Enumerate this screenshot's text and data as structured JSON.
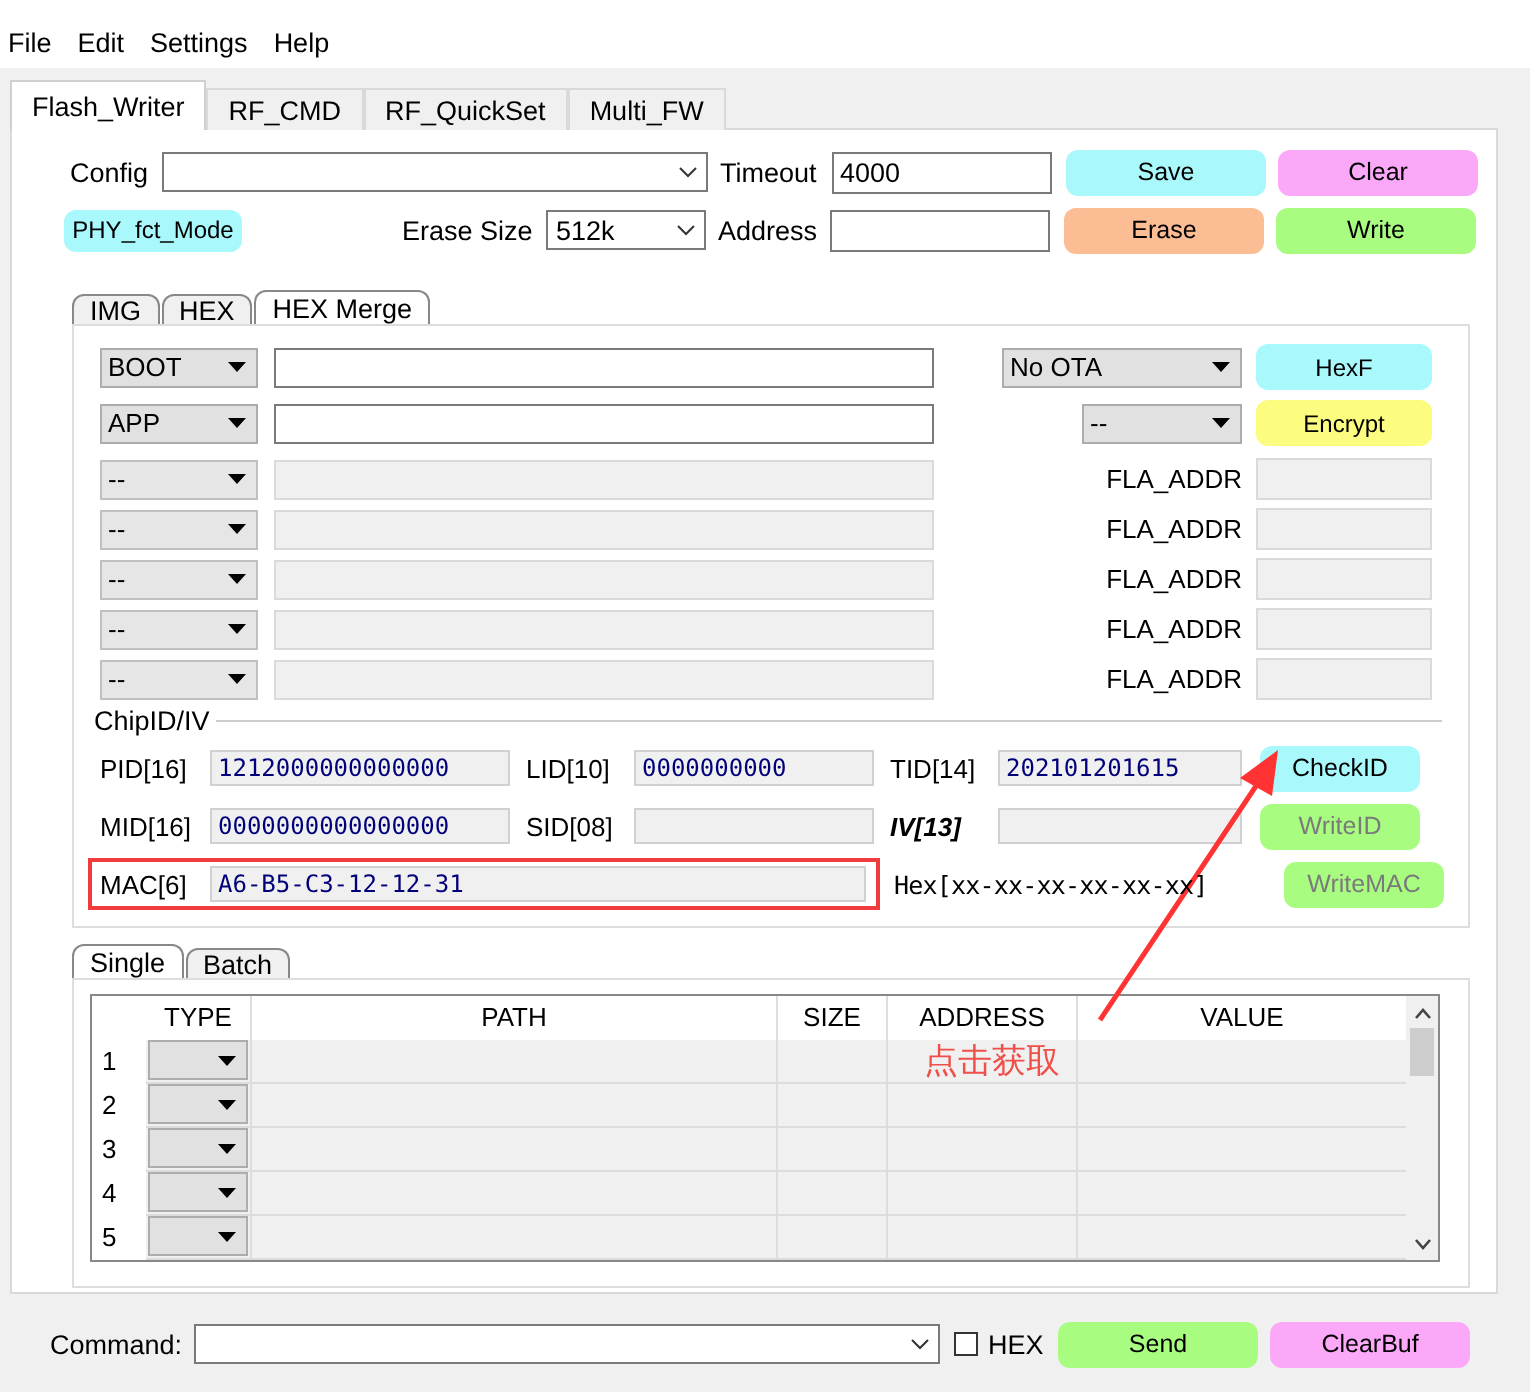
{
  "menu": [
    "File",
    "Edit",
    "Settings",
    "Help"
  ],
  "tabs": [
    {
      "label": "Flash_Writer",
      "selected": true
    },
    {
      "label": "RF_CMD",
      "selected": false
    },
    {
      "label": "RF_QuickSet",
      "selected": false
    },
    {
      "label": "Multi_FW",
      "selected": false
    }
  ],
  "config": {
    "label": "Config"
  },
  "timeout": {
    "label": "Timeout",
    "value": "4000"
  },
  "mode_button": {
    "label": "PHY_fct_Mode",
    "color": "#a8f8fc"
  },
  "erase_size": {
    "label": "Erase Size",
    "value": "512k"
  },
  "address": {
    "label": "Address"
  },
  "top_buttons": [
    {
      "label": "Save",
      "color": "#a8f8fc"
    },
    {
      "label": "Clear",
      "color": "#fca8f8"
    },
    {
      "label": "Erase",
      "color": "#fcbc94"
    },
    {
      "label": "Write",
      "color": "#a8fc80"
    }
  ],
  "sub_tabs": [
    {
      "label": "IMG",
      "selected": false
    },
    {
      "label": "HEX",
      "selected": false
    },
    {
      "label": "HEX Merge",
      "selected": true
    }
  ],
  "hex_rows": [
    {
      "type": "BOOT",
      "disabled": false,
      "kind": "button",
      "option": "No OTA",
      "button": {
        "label": "HexF",
        "color": "#a8f8fc"
      }
    },
    {
      "type": "APP",
      "disabled": false,
      "kind": "button",
      "option": "--",
      "button": {
        "label": "Encrypt",
        "color": "#fcfc80"
      }
    },
    {
      "type": "--",
      "disabled": true,
      "kind": "address",
      "address_label": "FLA_ADDR"
    },
    {
      "type": "--",
      "disabled": true,
      "kind": "address",
      "address_label": "FLA_ADDR"
    },
    {
      "type": "--",
      "disabled": true,
      "kind": "address",
      "address_label": "FLA_ADDR"
    },
    {
      "type": "--",
      "disabled": true,
      "kind": "address",
      "address_label": "FLA_ADDR"
    },
    {
      "type": "--",
      "disabled": true,
      "kind": "address",
      "address_label": "FLA_ADDR"
    }
  ],
  "chip_id": {
    "title": "ChipID/IV",
    "rows": [
      {
        "fields": [
          {
            "label": "PID[16]",
            "value": "1212000000000000",
            "bold": false
          },
          {
            "label": "LID[10]",
            "value": "0000000000",
            "bold": false
          },
          {
            "label": "TID[14]",
            "value": "202101201615",
            "bold": false
          }
        ],
        "button": {
          "label": "CheckID",
          "color": "#a8f8fc",
          "disabled": false
        }
      },
      {
        "fields": [
          {
            "label": "MID[16]",
            "value": "0000000000000000",
            "bold": false
          },
          {
            "label": "SID[08]",
            "bold": false
          },
          {
            "label": "IV[13]",
            "bold": true
          }
        ],
        "button": {
          "label": "WriteID",
          "color": "#a8fc80",
          "disabled": true
        }
      }
    ],
    "mac": {
      "label": "MAC[6]",
      "value": "A6-B5-C3-12-12-31",
      "highlighted": true,
      "hint": "Hex[xx-xx-xx-xx-xx-xx]"
    },
    "mac_button": {
      "label": "WriteMAC",
      "color": "#a8fc80",
      "disabled": true
    }
  },
  "lower_tabs": [
    {
      "label": "Single",
      "selected": true
    },
    {
      "label": "Batch",
      "selected": false
    }
  ],
  "table": {
    "columns": [
      "TYPE",
      "PATH",
      "SIZE",
      "ADDRESS",
      "VALUE"
    ],
    "rows": [
      {
        "index": "1"
      },
      {
        "index": "2"
      },
      {
        "index": "3"
      },
      {
        "index": "4"
      },
      {
        "index": "5"
      }
    ]
  },
  "annotation": {
    "text": "点击获取"
  },
  "command": {
    "label": "Command:"
  },
  "hex_check": {
    "label": "HEX",
    "checked": false
  },
  "bottom_buttons": [
    {
      "label": "Send",
      "color": "#a8fc80"
    },
    {
      "label": "ClearBuf",
      "color": "#fca8f8"
    }
  ]
}
